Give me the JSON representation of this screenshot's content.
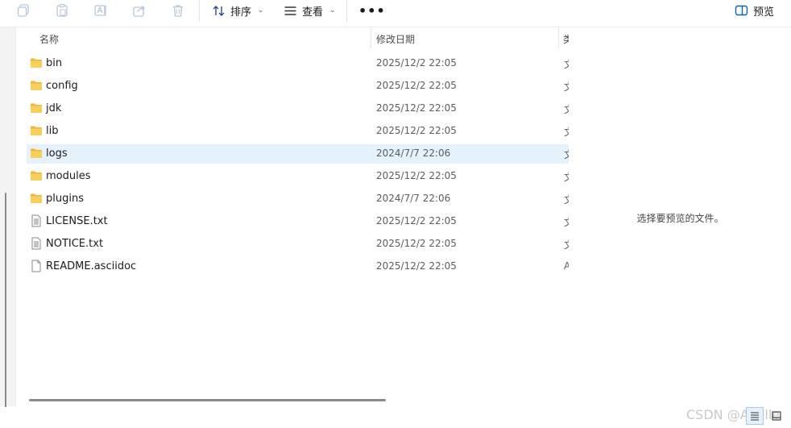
{
  "toolbar": {
    "sort_label": "排序",
    "view_label": "查看",
    "more_label": "•••",
    "preview_label": "预览"
  },
  "columns": {
    "name": "名称",
    "date": "修改日期",
    "type": "类"
  },
  "files": [
    {
      "name": "bin",
      "date": "2025/12/2 22:05",
      "type": "文",
      "kind": "folder"
    },
    {
      "name": "config",
      "date": "2025/12/2 22:05",
      "type": "文",
      "kind": "folder"
    },
    {
      "name": "jdk",
      "date": "2025/12/2 22:05",
      "type": "文",
      "kind": "folder"
    },
    {
      "name": "lib",
      "date": "2025/12/2 22:05",
      "type": "文",
      "kind": "folder"
    },
    {
      "name": "logs",
      "date": "2024/7/7 22:06",
      "type": "文",
      "kind": "folder",
      "selected": true
    },
    {
      "name": "modules",
      "date": "2025/12/2 22:05",
      "type": "文",
      "kind": "folder"
    },
    {
      "name": "plugins",
      "date": "2024/7/7 22:06",
      "type": "文",
      "kind": "folder"
    },
    {
      "name": "LICENSE.txt",
      "date": "2025/12/2 22:05",
      "type": "文",
      "kind": "text"
    },
    {
      "name": "NOTICE.txt",
      "date": "2025/12/2 22:05",
      "type": "文",
      "kind": "text"
    },
    {
      "name": "README.asciidoc",
      "date": "2025/12/2 22:05",
      "type": "A",
      "kind": "file"
    }
  ],
  "preview": {
    "empty_message": "选择要预览的文件。"
  },
  "watermark": "CSDN @Adelle",
  "colors": {
    "folder": "#f8c43b",
    "selection": "#e5f1fb",
    "accent": "#0067c0"
  }
}
